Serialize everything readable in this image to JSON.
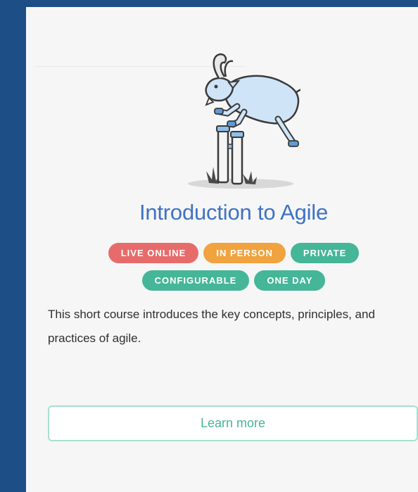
{
  "course_card": {
    "illustration": "goat-jumping-hurdle-icon",
    "title": "Introduction to Agile",
    "tags_row1": [
      {
        "label": "LIVE ONLINE",
        "color": "#e86b6b"
      },
      {
        "label": "IN PERSON",
        "color": "#f0a33e"
      },
      {
        "label": "PRIVATE",
        "color": "#45b698"
      }
    ],
    "tags_row2": [
      {
        "label": "CONFIGURABLE",
        "color": "#45b698"
      },
      {
        "label": "ONE DAY",
        "color": "#45b698"
      }
    ],
    "description": "This short course introduces the key concepts, principles, and practices of agile.",
    "cta_label": "Learn more"
  },
  "colors": {
    "background": "#1d4f86",
    "title": "#3f72c4",
    "accent": "#49b497"
  }
}
